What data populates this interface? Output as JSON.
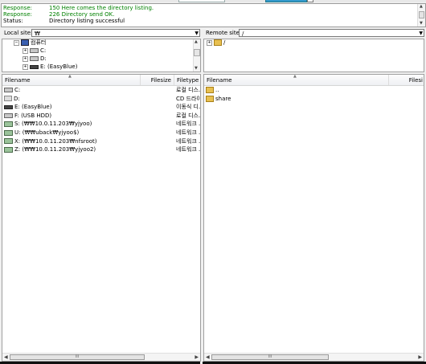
{
  "log": {
    "lines": [
      {
        "label": "Response:",
        "text": "150 Here comes the directory listing.",
        "green": true
      },
      {
        "label": "Response:",
        "text": "226 Directory send OK.",
        "green": true
      },
      {
        "label": "Status:",
        "text": "Directory listing successful",
        "green": false
      }
    ]
  },
  "local": {
    "site_label": "Local site:",
    "site_path": "₩",
    "tree": [
      {
        "label": "컴퓨터",
        "icon": "computer-icon"
      },
      {
        "label": "C:",
        "icon": "drive-icon"
      },
      {
        "label": "D:",
        "icon": "drive-icon"
      },
      {
        "label": "E: (EasyBlue)",
        "icon": "usb-drive-icon"
      }
    ],
    "columns": {
      "name": "Filename",
      "size": "Filesize",
      "type": "Filetype"
    },
    "rows": [
      {
        "name": "C:",
        "size": "",
        "type": "로컬 디스...",
        "icon": "drive-icon"
      },
      {
        "name": "D:",
        "size": "",
        "type": "CD 드라이...",
        "icon": "cd-drive-icon"
      },
      {
        "name": "E: (EasyBlue)",
        "size": "",
        "type": "이동식 디...",
        "icon": "usb-drive-icon"
      },
      {
        "name": "F: (USB HDD)",
        "size": "",
        "type": "로컬 디스...",
        "icon": "drive-icon"
      },
      {
        "name": "S: (₩₩10.0.11.203₩yjyoo)",
        "size": "",
        "type": "네트워크 ...",
        "icon": "network-drive-icon"
      },
      {
        "name": "U: (₩₩uback₩yjyoo$)",
        "size": "",
        "type": "네트워크 ...",
        "icon": "network-drive-icon"
      },
      {
        "name": "X: (₩₩10.0.11.203₩nfsroot)",
        "size": "",
        "type": "네트워크 ...",
        "icon": "network-drive-icon"
      },
      {
        "name": "Z: (₩₩10.0.11.203₩yjyoo2)",
        "size": "",
        "type": "네트워크 ...",
        "icon": "network-drive-icon"
      }
    ]
  },
  "remote": {
    "site_label": "Remote site:",
    "site_path": "/",
    "tree": [
      {
        "label": "/",
        "icon": "folder-icon"
      }
    ],
    "columns": {
      "name": "Filename",
      "size": "Filesi"
    },
    "rows": [
      {
        "name": "..",
        "icon": "folder-icon"
      },
      {
        "name": "share",
        "icon": "folder-icon"
      }
    ]
  },
  "scroll": {
    "thumb_grip": "III"
  }
}
